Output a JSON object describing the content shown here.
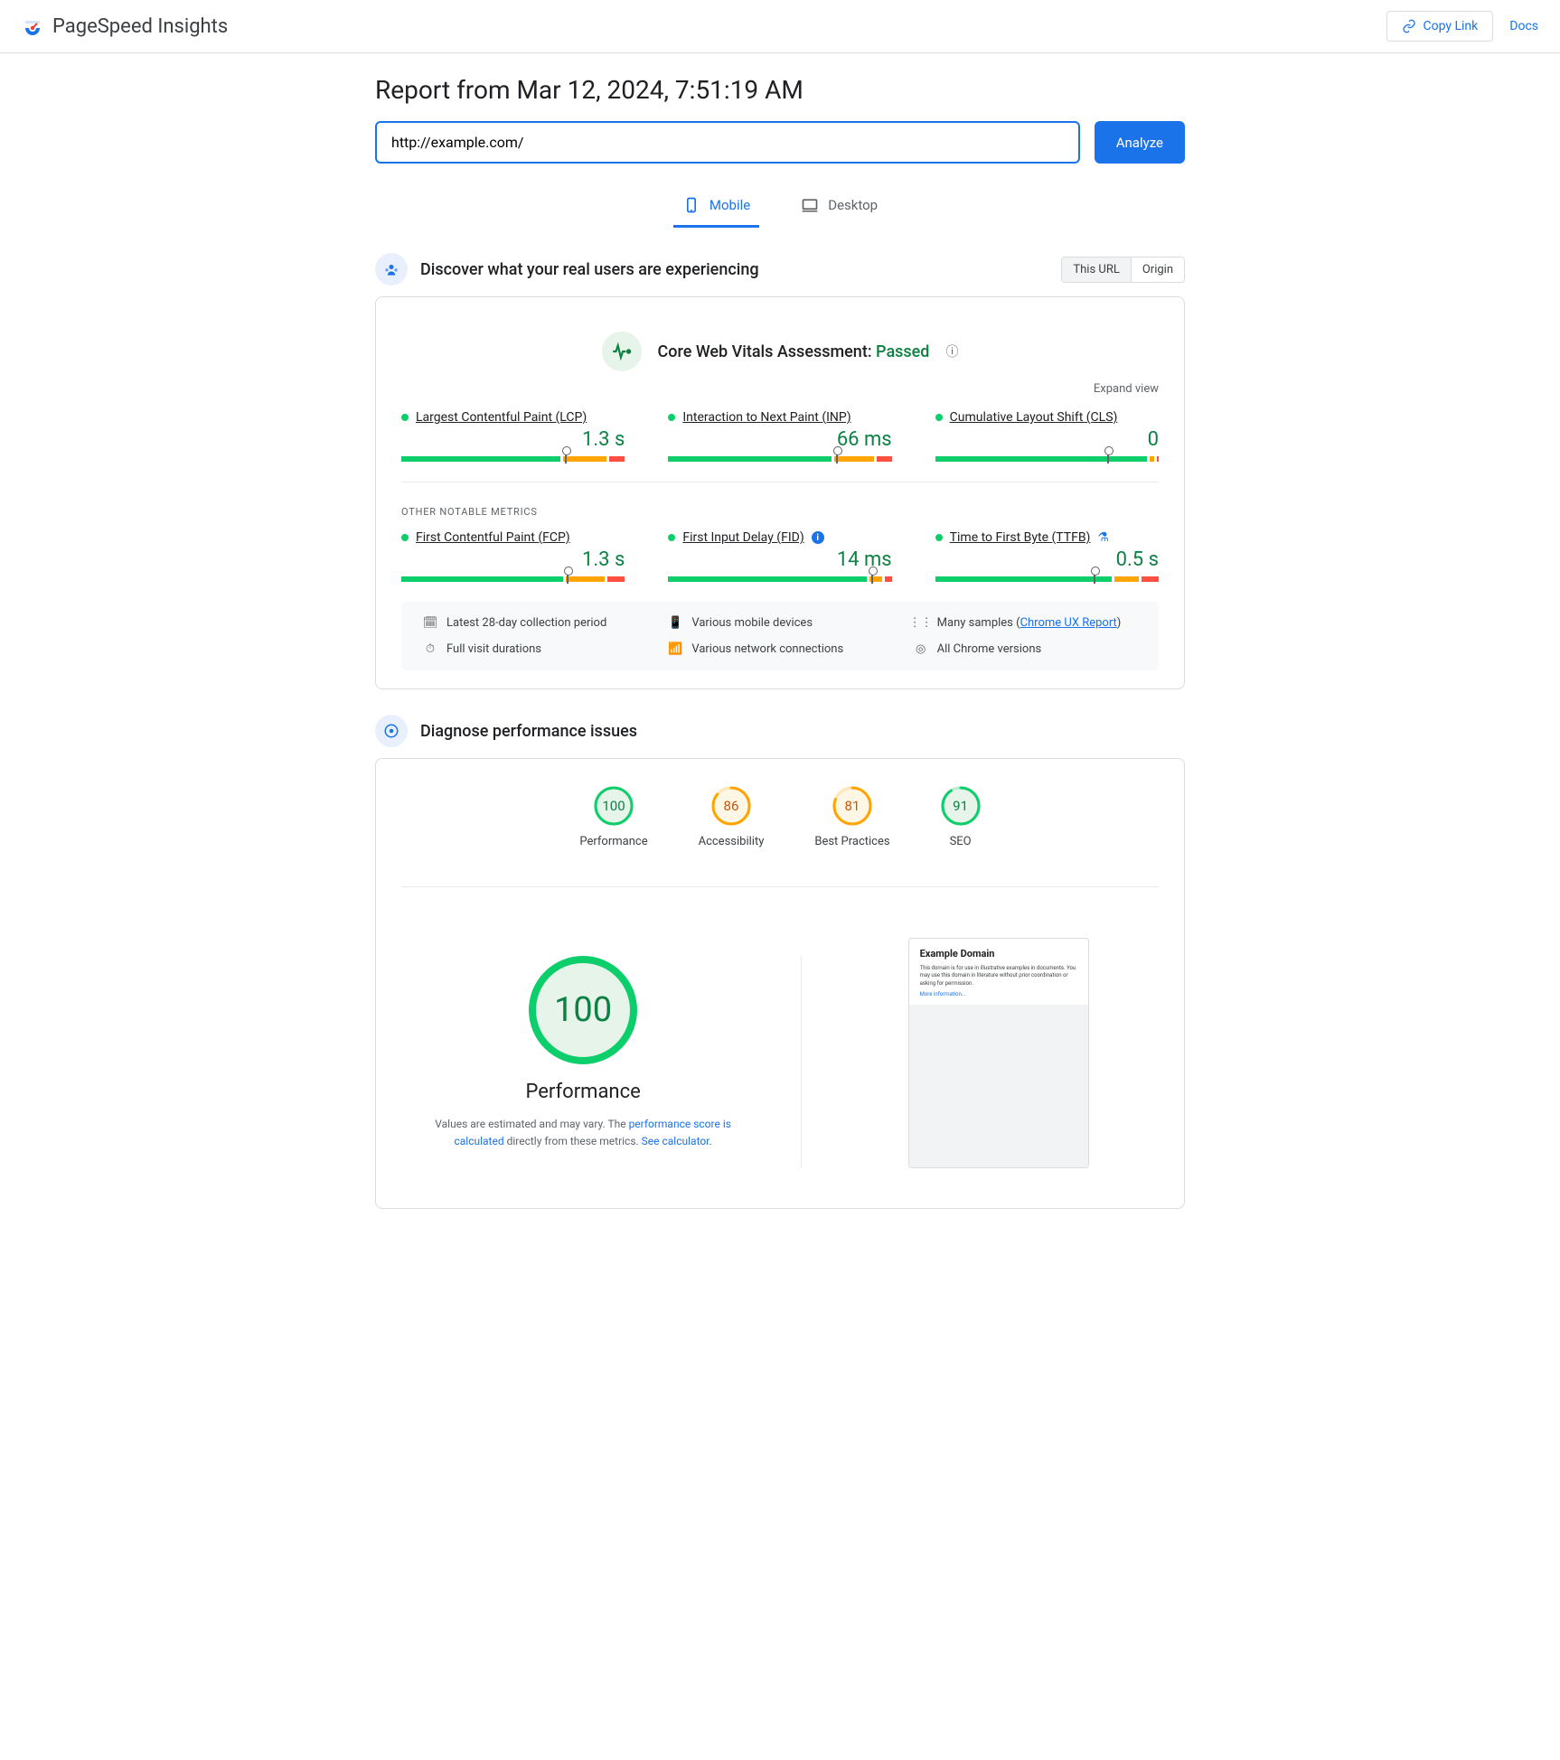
{
  "header": {
    "brand": "PageSpeed Insights",
    "copy_link": "Copy Link",
    "docs": "Docs"
  },
  "report": {
    "title": "Report from Mar 12, 2024, 7:51:19 AM",
    "url_value": "http://example.com/",
    "analyze": "Analyze"
  },
  "tabs": {
    "mobile": "Mobile",
    "desktop": "Desktop"
  },
  "crux": {
    "section_title": "Discover what your real users are experiencing",
    "toggle_url": "This URL",
    "toggle_origin": "Origin",
    "assessment_label": "Core Web Vitals Assessment: ",
    "assessment_status": "Passed",
    "expand": "Expand view",
    "other_header": "OTHER NOTABLE METRICS",
    "metrics": {
      "lcp": {
        "name": "Largest Contentful Paint (LCP)",
        "value": "1.3 s",
        "g": 73,
        "o": 20,
        "r": 7,
        "marker": 73
      },
      "inp": {
        "name": "Interaction to Next Paint (INP)",
        "value": "66 ms",
        "g": 75,
        "o": 18,
        "r": 7,
        "marker": 75
      },
      "cls": {
        "name": "Cumulative Layout Shift (CLS)",
        "value": "0",
        "g": 97,
        "o": 2,
        "r": 1,
        "marker": 77
      },
      "fcp": {
        "name": "First Contentful Paint (FCP)",
        "value": "1.3 s",
        "g": 74,
        "o": 18,
        "r": 8,
        "marker": 74
      },
      "fid": {
        "name": "First Input Delay (FID)",
        "value": "14 ms",
        "g": 91,
        "o": 6,
        "r": 3,
        "marker": 91
      },
      "ttfb": {
        "name": "Time to First Byte (TTFB)",
        "value": "0.5 s",
        "g": 81,
        "o": 11,
        "r": 8,
        "marker": 71
      }
    },
    "meta": {
      "period": "Latest 28-day collection period",
      "devices": "Various mobile devices",
      "samples_prefix": "Many samples (",
      "samples_link": "Chrome UX Report",
      "samples_suffix": ")",
      "durations": "Full visit durations",
      "networks": "Various network connections",
      "versions": "All Chrome versions"
    }
  },
  "lighthouse": {
    "section_title": "Diagnose performance issues",
    "scores": {
      "performance": {
        "label": "Performance",
        "score": "100",
        "color": "#0cce6b",
        "bg": "#e6f4ea",
        "text": "#0d8043",
        "pct": 100
      },
      "accessibility": {
        "label": "Accessibility",
        "score": "86",
        "color": "#ffa400",
        "bg": "#fff7e6",
        "text": "#c3570b",
        "pct": 86
      },
      "best": {
        "label": "Best Practices",
        "score": "81",
        "color": "#ffa400",
        "bg": "#fff7e6",
        "text": "#c3570b",
        "pct": 81
      },
      "seo": {
        "label": "SEO",
        "score": "91",
        "color": "#0cce6b",
        "bg": "#e6f4ea",
        "text": "#0d8043",
        "pct": 91
      }
    },
    "big": {
      "score": "100",
      "title": "Performance",
      "desc_prefix": "Values are estimated and may vary. The ",
      "desc_link1": "performance score is calculated",
      "desc_mid": " directly from these metrics. ",
      "desc_link2": "See calculator."
    },
    "preview": {
      "title": "Example Domain",
      "text": "This domain is for use in illustrative examples in documents. You may use this domain in literature without prior coordination or asking for permission.",
      "more": "More information..."
    }
  }
}
